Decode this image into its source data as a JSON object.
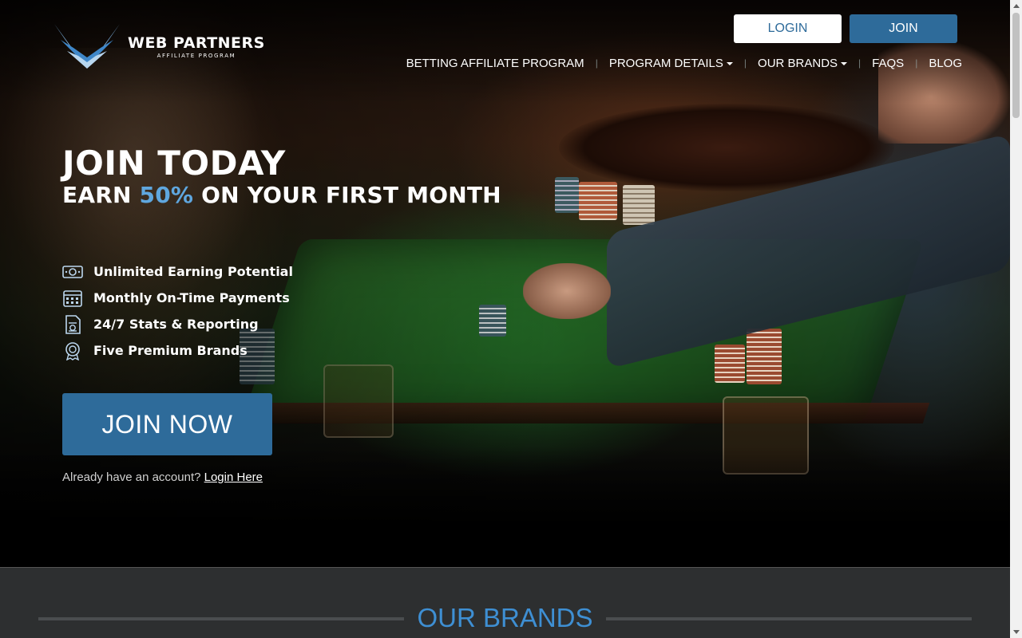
{
  "logo": {
    "title": "WEB PARTNERS",
    "subtitle": "AFFILIATE PROGRAM"
  },
  "header": {
    "login_label": "LOGIN",
    "join_label": "JOIN"
  },
  "nav": {
    "items": [
      {
        "label": "BETTING AFFILIATE PROGRAM",
        "dropdown": false
      },
      {
        "label": "PROGRAM DETAILS",
        "dropdown": true
      },
      {
        "label": "OUR BRANDS",
        "dropdown": true
      },
      {
        "label": "FAQS",
        "dropdown": false
      },
      {
        "label": "BLOG",
        "dropdown": false
      }
    ],
    "separator": "|"
  },
  "hero": {
    "headline": "JOIN TODAY",
    "sub_prefix": "EARN ",
    "sub_accent": "50%",
    "sub_suffix": " ON YOUR FIRST MONTH",
    "features": [
      {
        "icon": "cash-icon",
        "label": "Unlimited Earning Potential"
      },
      {
        "icon": "calendar-icon",
        "label": "Monthly On-Time Payments"
      },
      {
        "icon": "report-icon",
        "label": "24/7 Stats & Reporting"
      },
      {
        "icon": "award-icon",
        "label": "Five Premium Brands"
      }
    ],
    "cta_label": "JOIN NOW",
    "account_text": "Already have an account? ",
    "account_link": "Login Here"
  },
  "brands": {
    "title": "OUR BRANDS"
  },
  "colors": {
    "accent": "#2e6b9a",
    "highlight": "#5fa7df",
    "brand_title": "#3e8fd3",
    "section_bg": "#2d2f30"
  }
}
